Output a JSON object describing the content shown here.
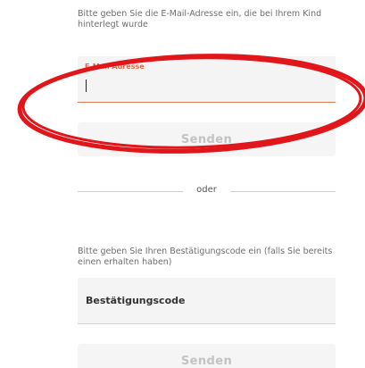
{
  "email_section": {
    "instruction": "Bitte geben Sie die E-Mail-Adresse ein, die bei Ihrem Kind hinterlegt wurde",
    "field_label": "E-Mail Adresse",
    "field_value": "",
    "button_label": "Senden"
  },
  "divider": {
    "label": "oder"
  },
  "code_section": {
    "instruction": "Bitte geben Sie Ihren Bestätigungscode ein (falls Sie bereits einen erhalten haben)",
    "field_placeholder": "Bestätigungscode",
    "button_label": "Senden"
  },
  "colors": {
    "annotation": "#e0161b",
    "field_label": "#e0684a",
    "field_underline": "#e37a55",
    "button_background": "#f5f5f5",
    "button_text": "#c3c3c3"
  }
}
